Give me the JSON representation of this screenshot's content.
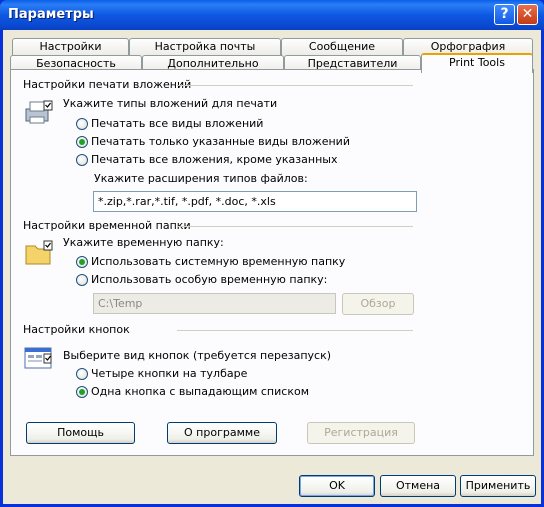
{
  "window": {
    "title": "Параметры"
  },
  "tabs_row1": [
    "Настройки",
    "Настройка почты",
    "Сообщение",
    "Орфография"
  ],
  "tabs_row2": [
    "Безопасность",
    "Дополнительно",
    "Представители",
    "Print Tools"
  ],
  "print": {
    "header": "Настройки печати вложений",
    "prompt": "Укажите типы вложений для печати",
    "options": [
      "Печатать все виды вложений",
      "Печатать только указанные виды вложений",
      "Печатать все вложения, кроме указанных"
    ],
    "selected": 1,
    "ext_label": "Укажите расширения типов файлов:",
    "ext_value": "*.zip,*.rar,*.tif, *.pdf, *.doc, *.xls"
  },
  "temp": {
    "header": "Настройки временной папки",
    "prompt": "Укажите временную папку:",
    "options": [
      "Использовать системную временную папку",
      "Использовать особую временную папку:"
    ],
    "selected": 0,
    "path_value": "C:\\Temp",
    "browse_label": "Обзор"
  },
  "buttons_section": {
    "header": "Настройки кнопок",
    "prompt": "Выберите вид кнопок (требуется перезапуск)",
    "options": [
      "Четыре кнопки на тулбаре",
      "Одна кнопка с выпадающим списком"
    ],
    "selected": 1
  },
  "panel_buttons": {
    "help": "Помощь",
    "about": "О программе",
    "register": "Регистрация"
  },
  "dialog_buttons": {
    "ok": "OK",
    "cancel": "Отмена",
    "apply": "Применить"
  }
}
